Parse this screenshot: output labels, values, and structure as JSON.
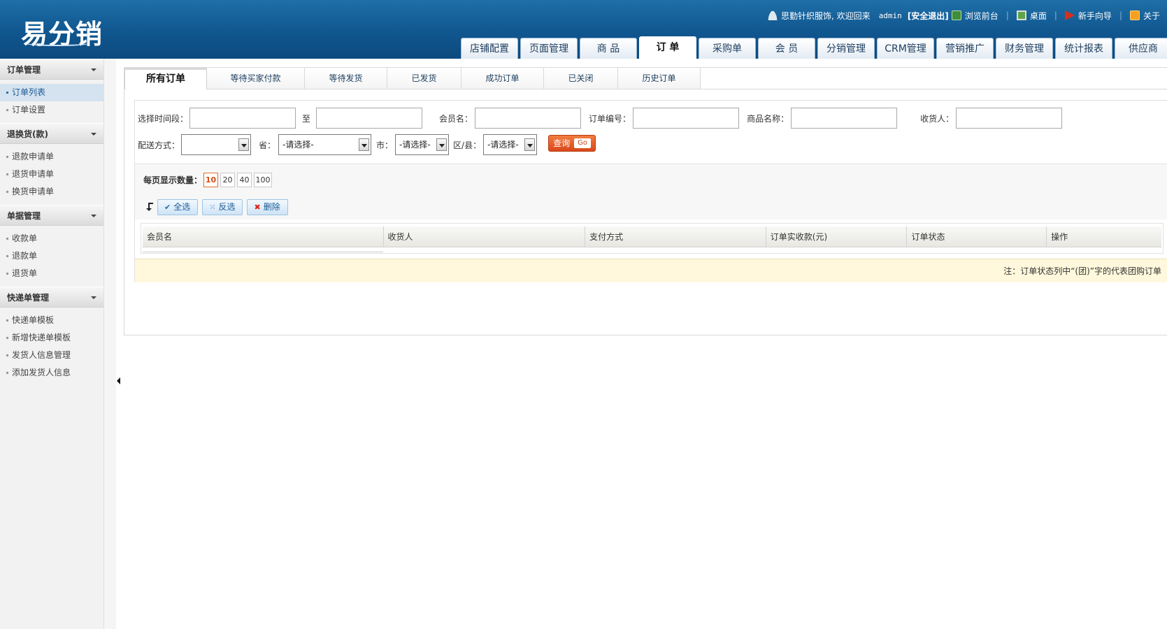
{
  "header": {
    "logo": "易分销",
    "welcome": "思勤针织服饰, 欢迎回来",
    "username": "admin",
    "logout": "[安全退出]",
    "links": [
      {
        "label": "浏览前台",
        "icon": "browse-icon"
      },
      {
        "label": "桌面",
        "icon": "desktop-icon"
      },
      {
        "label": "新手向导",
        "icon": "guide-flag-icon"
      },
      {
        "label": "关于",
        "icon": "about-icon"
      }
    ],
    "tabs": [
      "店铺配置",
      "页面管理",
      "商 品",
      "订 单",
      "采购单",
      "会 员",
      "分销管理",
      "CRM管理",
      "营销推广",
      "财务管理",
      "统计报表",
      "供应商"
    ],
    "active_tab": "订 单"
  },
  "sidebar": {
    "groups": [
      {
        "title": "订单管理",
        "items": [
          "订单列表",
          "订单设置"
        ]
      },
      {
        "title": "退换货(款)",
        "items": [
          "退款申请单",
          "退货申请单",
          "换货申请单"
        ]
      },
      {
        "title": "单据管理",
        "items": [
          "收款单",
          "退款单",
          "退货单"
        ]
      },
      {
        "title": "快递单管理",
        "items": [
          "快递单模板",
          "新增快递单模板",
          "发货人信息管理",
          "添加发货人信息"
        ]
      }
    ],
    "active_item": "订单列表"
  },
  "subtabs": [
    "所有订单",
    "等待买家付款",
    "等待发货",
    "已发货",
    "成功订单",
    "已关闭",
    "历史订单"
  ],
  "filters": {
    "time_label": "选择时间段：",
    "to_label": "至",
    "member_label": "会员名：",
    "order_no_label": "订单编号：",
    "product_label": "商品名称：",
    "receiver_label": "收货人：",
    "shipping_label": "配送方式：",
    "shipping_value": "",
    "province_label": "省：",
    "province_value": "-请选择-",
    "city_label": "市：",
    "city_value": "-请选择-",
    "district_label": "区/县：",
    "district_value": "-请选择-",
    "query_label": "查询",
    "query_go": "Go"
  },
  "pagesize": {
    "label": "每页显示数量：",
    "options": [
      "10",
      "20",
      "40",
      "100"
    ],
    "selected": "10"
  },
  "actions": {
    "select_all": "全选",
    "invert": "反选",
    "delete": "删除"
  },
  "table": {
    "columns": [
      "会员名",
      "收货人",
      "支付方式",
      "订单实收款(元)",
      "订单状态",
      "操作"
    ],
    "rows": []
  },
  "note": "注：订单状态列中“(团)”字的代表团购订单",
  "colors": {
    "header_bg": "#10568f",
    "accent_orange": "#d9481b",
    "note_bg": "#fff8dc",
    "active_side_bg": "#d5e3f0"
  }
}
